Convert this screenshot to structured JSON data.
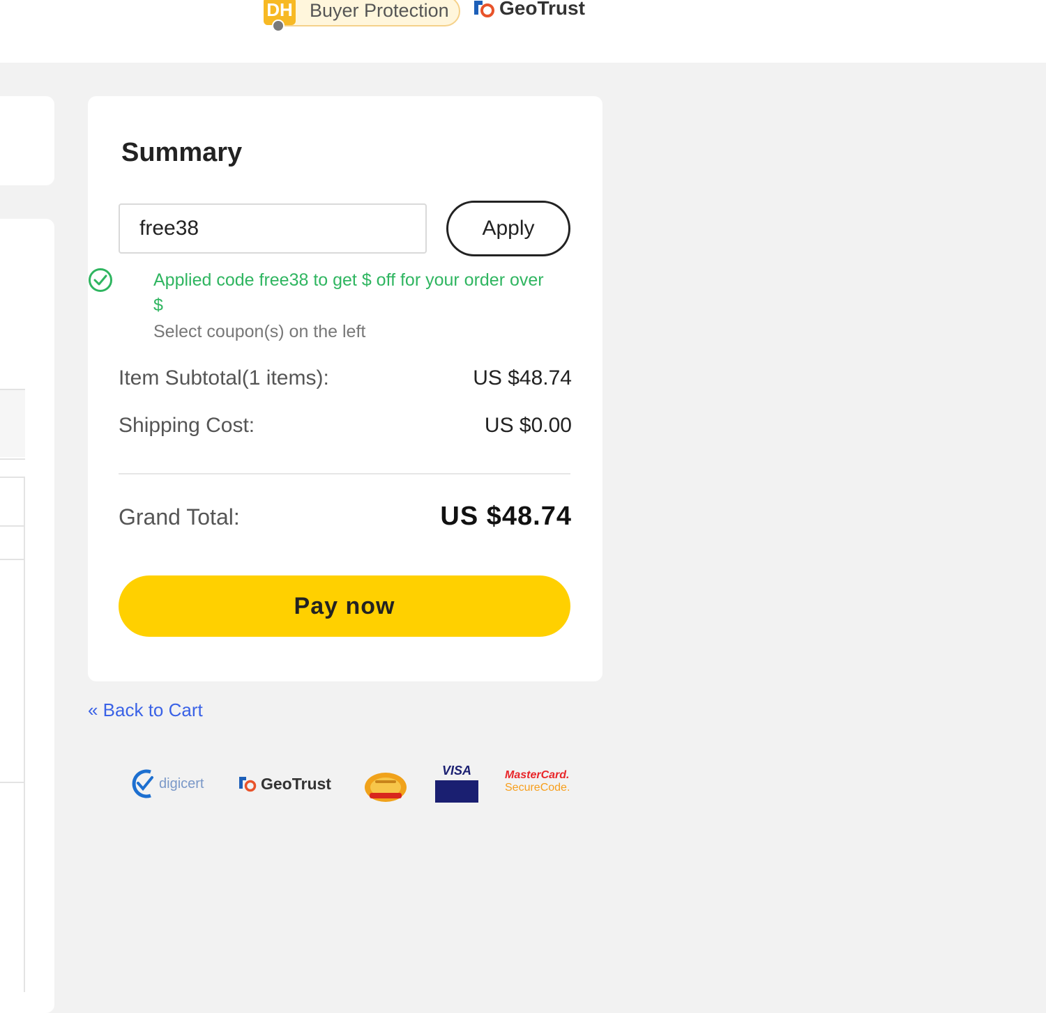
{
  "header": {
    "buyer_protection_badge": "DH",
    "buyer_protection_label": "Buyer Protection",
    "geotrust_label": "GeoTrust"
  },
  "summary": {
    "title": "Summary",
    "coupon_value": "free38",
    "apply_label": "Apply",
    "applied_message": "Applied code free38 to get $ off for your order over $",
    "select_coupon_message": "Select coupon(s) on the left",
    "item_subtotal_label": "Item Subtotal(1 items):",
    "item_subtotal_value": "US $48.74",
    "shipping_label": "Shipping Cost:",
    "shipping_value": "US $0.00",
    "grand_total_label": "Grand Total:",
    "grand_total_value": "US $48.74",
    "pay_label": "Pay now"
  },
  "back_link": "« Back to Cart",
  "badges": {
    "digicert": "digicert",
    "geotrust": "GeoTrust",
    "visa": "VISA",
    "mastercard_line1": "MasterCard.",
    "mastercard_line2": "SecureCode."
  },
  "colors": {
    "accent_yellow": "#ffd000",
    "success_green": "#2fb560",
    "link_blue": "#3a62e6",
    "background": "#f2f2f2"
  }
}
